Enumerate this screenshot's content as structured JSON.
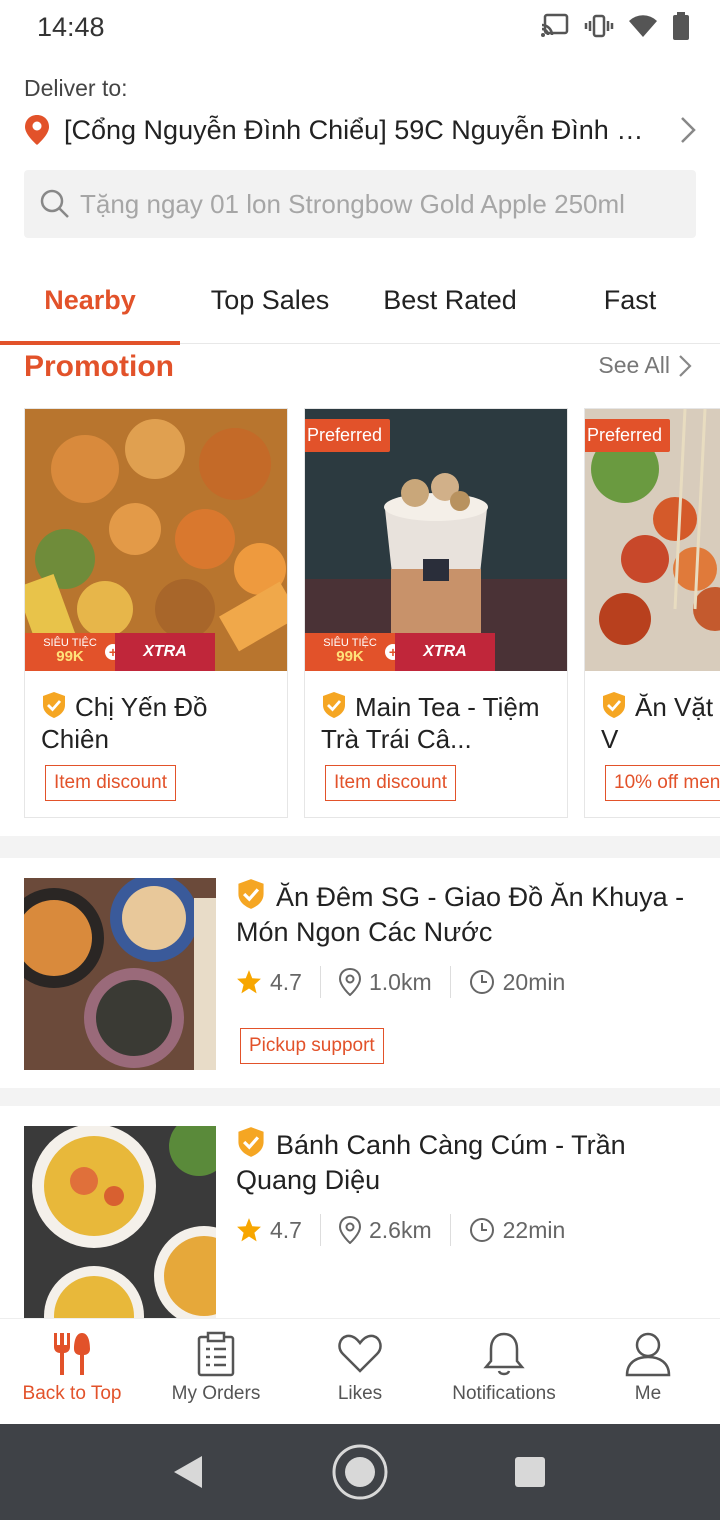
{
  "status_bar": {
    "time": "14:48"
  },
  "header": {
    "deliver_label": "Deliver to:",
    "address": "[Cổng Nguyễn Đình Chiểu] 59C Nguyễn Đình C..."
  },
  "search": {
    "placeholder": "Tặng ngay 01 lon Strongbow Gold Apple 250ml"
  },
  "tabs": [
    {
      "label": "Nearby"
    },
    {
      "label": "Top Sales"
    },
    {
      "label": "Best Rated"
    },
    {
      "label": "Fast"
    }
  ],
  "promotion": {
    "title": "Promotion",
    "see_all": "See All",
    "cards": [
      {
        "name": "Chị Yến Đồ Chiên",
        "tag": "Item discount",
        "preferred": "",
        "banner_left_top": "SIÊU TIỆC",
        "banner_left_bottom": "99K",
        "banner_right": "XTRA"
      },
      {
        "name": "Main Tea - Tiệm Trà Trái Câ...",
        "tag": "Item discount",
        "preferred": "Preferred",
        "banner_left_top": "SIÊU TIỆC",
        "banner_left_bottom": "99K",
        "banner_right": "XTRA"
      },
      {
        "name": "Ăn Vặt Miu - Cá V",
        "tag": "10% off men",
        "preferred": "Preferred"
      }
    ]
  },
  "restaurants": [
    {
      "name": "Ăn Đêm SG - Giao Đồ Ăn Khuya - Món Ngon Các Nước",
      "rating": "4.7",
      "distance": "1.0km",
      "time": "20min",
      "tag": "Pickup support"
    },
    {
      "name": "Bánh Canh Càng Cúm - Trần Quang Diệu",
      "rating": "4.7",
      "distance": "2.6km",
      "time": "22min"
    }
  ],
  "bottom_nav": [
    {
      "label": "Back to Top",
      "icon": "fork-knife-icon"
    },
    {
      "label": "My Orders",
      "icon": "clipboard-icon"
    },
    {
      "label": "Likes",
      "icon": "heart-icon"
    },
    {
      "label": "Notifications",
      "icon": "bell-icon"
    },
    {
      "label": "Me",
      "icon": "person-icon"
    }
  ],
  "colors": {
    "accent": "#e2522a",
    "star": "#f7a600",
    "badge": "#f5a623",
    "system_nav": "#3f4247"
  }
}
